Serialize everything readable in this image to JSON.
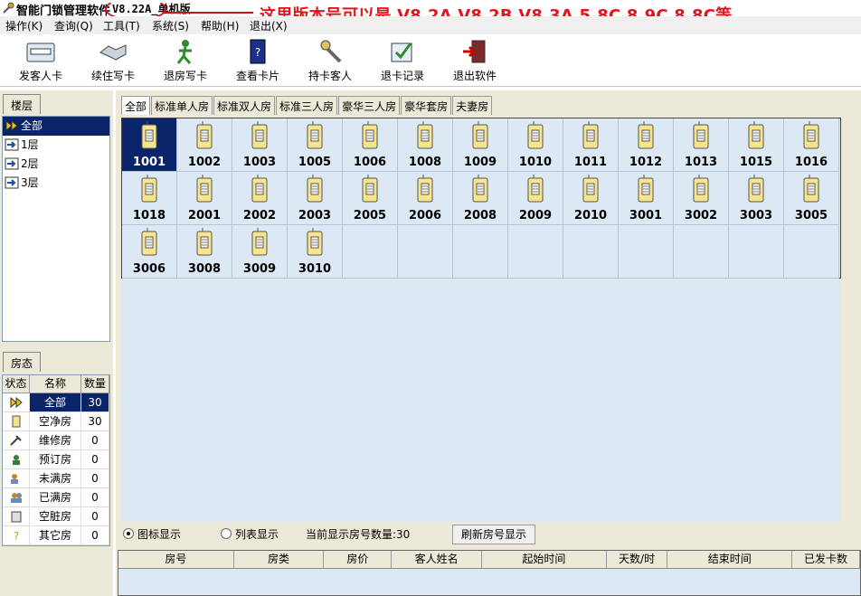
{
  "window": {
    "title": "智能门锁管理软件",
    "version": "V8.22A_单机版",
    "annotation": "这里版本号可以是 V8.2A V8.2B V8.3A 5.8C 8.9C  8.8C等，"
  },
  "menu": [
    "操作(K)",
    "查询(Q)",
    "工具(T)",
    "系统(S)",
    "帮助(H)",
    "退出(X)"
  ],
  "toolbar": [
    {
      "label": "发客人卡",
      "icon": "card-icon"
    },
    {
      "label": "续住写卡",
      "icon": "handshake-icon"
    },
    {
      "label": "退房写卡",
      "icon": "checkout-icon"
    },
    {
      "label": "查看卡片",
      "icon": "view-card-icon"
    },
    {
      "label": "持卡客人",
      "icon": "cardholder-icon"
    },
    {
      "label": "退卡记录",
      "icon": "return-record-icon"
    },
    {
      "label": "退出软件",
      "icon": "exit-icon"
    }
  ],
  "floors": {
    "tab": "楼层",
    "items": [
      {
        "label": "全部",
        "selected": true
      },
      {
        "label": "1层",
        "selected": false
      },
      {
        "label": "2层",
        "selected": false
      },
      {
        "label": "3层",
        "selected": false
      }
    ]
  },
  "status": {
    "tab": "房态",
    "headers": [
      "状态",
      "名称",
      "数量"
    ],
    "rows": [
      {
        "name": "全部",
        "count": "30",
        "icon": "all-icon",
        "selected": true
      },
      {
        "name": "空净房",
        "count": "30",
        "icon": "vacant-icon"
      },
      {
        "name": "维修房",
        "count": "0",
        "icon": "repair-icon"
      },
      {
        "name": "预订房",
        "count": "0",
        "icon": "reserved-icon"
      },
      {
        "name": "未满房",
        "count": "0",
        "icon": "partial-icon"
      },
      {
        "name": "已满房",
        "count": "0",
        "icon": "full-icon"
      },
      {
        "name": "空脏房",
        "count": "0",
        "icon": "dirty-icon"
      },
      {
        "name": "其它房",
        "count": "0",
        "icon": "other-icon"
      }
    ]
  },
  "room_tabs": [
    "全部",
    "标准单人房",
    "标准双人房",
    "标准三人房",
    "豪华三人房",
    "豪华套房",
    "夫妻房"
  ],
  "rooms": [
    "1001",
    "1002",
    "1003",
    "1005",
    "1006",
    "1008",
    "1009",
    "1010",
    "1011",
    "1012",
    "1013",
    "1015",
    "1016",
    "1018",
    "2001",
    "2002",
    "2003",
    "2005",
    "2006",
    "2008",
    "2009",
    "2010",
    "3001",
    "3002",
    "3003",
    "3005",
    "3006",
    "3008",
    "3009",
    "3010"
  ],
  "selected_room": "1001",
  "bottom": {
    "icon_view": "图标显示",
    "list_view": "列表显示",
    "count_text": "当前显示房号数量:30",
    "refresh": "刷新房号显示"
  },
  "list_headers": [
    "房号",
    "房类",
    "房价",
    "客人姓名",
    "起始时间",
    "天数/时",
    "结束时间",
    "已发卡数"
  ],
  "colors": {
    "selection": "#0a246a",
    "grid_bg": "#dde8f5",
    "annotation": "#e3141e"
  }
}
